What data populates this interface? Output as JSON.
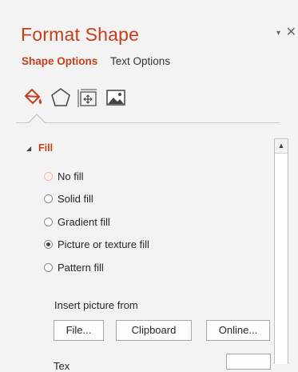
{
  "header": {
    "title": "Format Shape",
    "menu_glyph": "▾",
    "close_glyph": "✕",
    "tabs": [
      {
        "label": "Shape Options",
        "active": true
      },
      {
        "label": "Text Options",
        "active": false
      }
    ]
  },
  "icon_tabs": [
    {
      "name": "fill-line-icon",
      "active": true
    },
    {
      "name": "effects-icon",
      "active": false
    },
    {
      "name": "size-properties-icon",
      "active": false
    },
    {
      "name": "picture-icon",
      "active": false
    }
  ],
  "fill_section": {
    "title": "Fill",
    "toggle_glyph": "◢",
    "options": [
      {
        "label": "No fill",
        "selected": false
      },
      {
        "label": "Solid fill",
        "selected": false
      },
      {
        "label": "Gradient fill",
        "selected": false
      },
      {
        "label": "Picture or texture fill",
        "selected": true
      },
      {
        "label": "Pattern fill",
        "selected": false
      }
    ],
    "insert_label": "Insert picture from",
    "buttons": {
      "file": "File...",
      "clipboard": "Clipboard",
      "online": "Online..."
    },
    "partial_label": "Tex"
  },
  "scroll_up_glyph": "▲",
  "colors": {
    "accent": "#c43e1c",
    "pane_bg": "#f3f3f3"
  }
}
